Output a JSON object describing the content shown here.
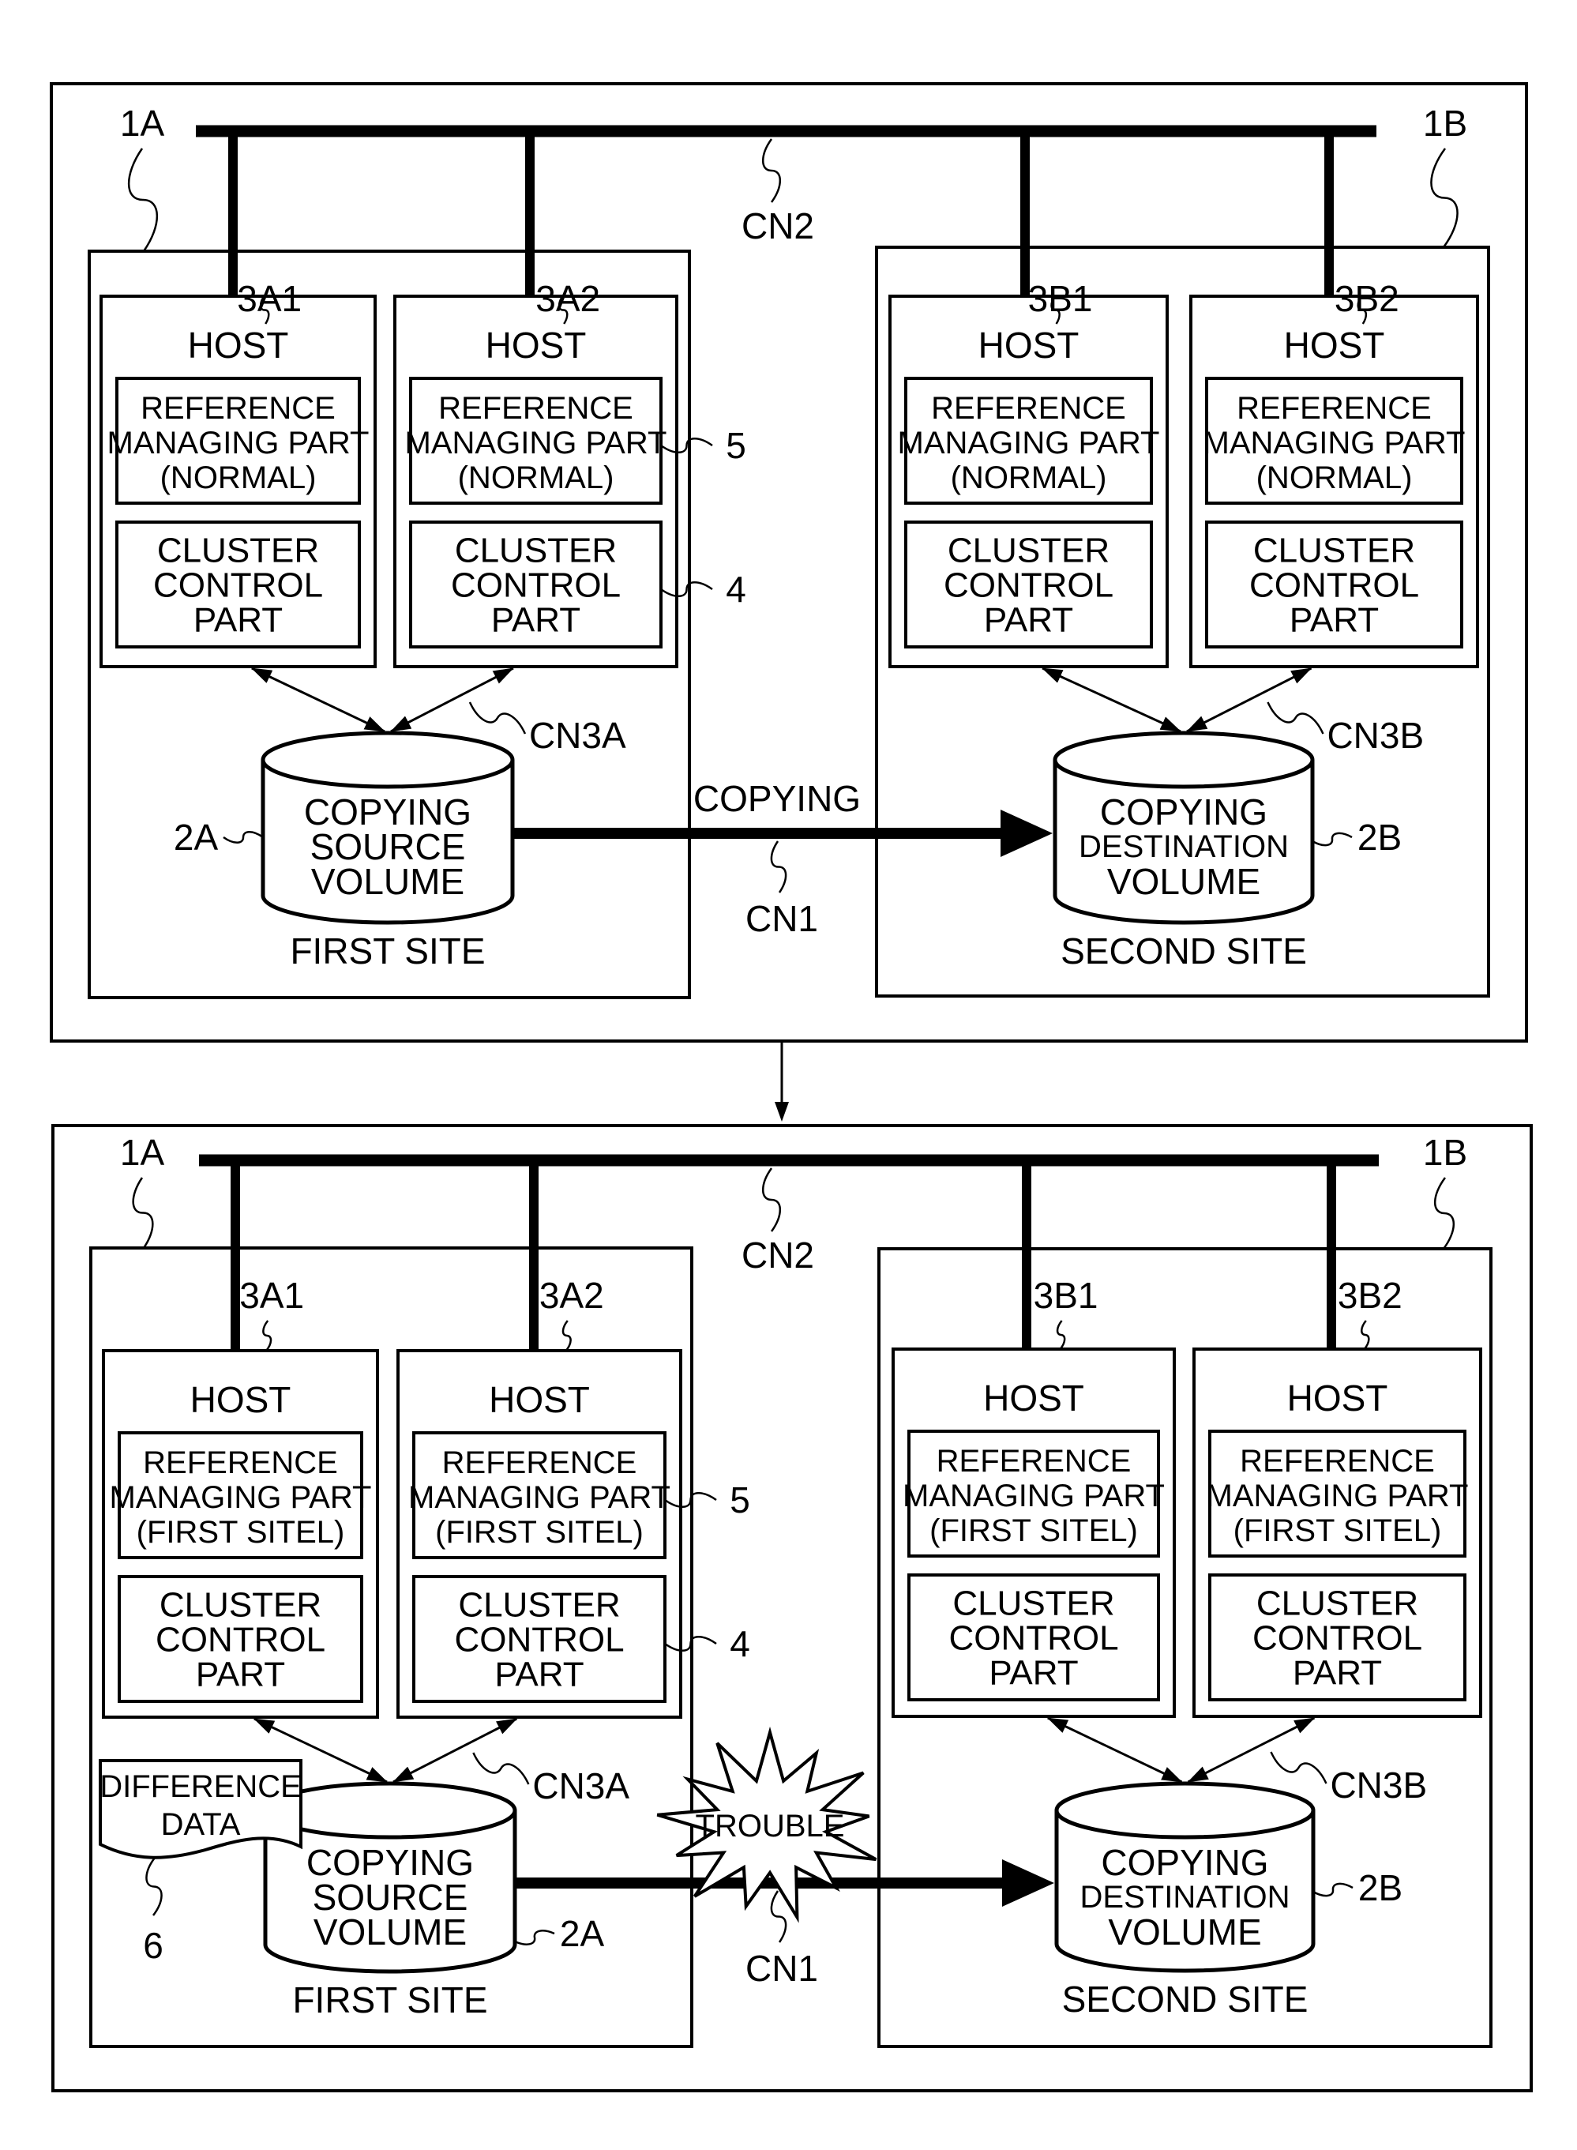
{
  "figure": {
    "colors": {
      "ink": "#000000",
      "paper": "#ffffff"
    },
    "panels": [
      {
        "id": "normal",
        "network_label": "CN2",
        "sites": [
          {
            "ref": "1A",
            "title": "FIRST SITE",
            "hosts": [
              {
                "ref": "3A1",
                "title": "HOST",
                "reference_part": [
                  "REFERENCE",
                  "MANAGING PART",
                  "(NORMAL)"
                ],
                "cluster_part": [
                  "CLUSTER",
                  "CONTROL",
                  "PART"
                ]
              },
              {
                "ref": "3A2",
                "title": "HOST",
                "reference_part": [
                  "REFERENCE",
                  "MANAGING PART",
                  "(NORMAL)"
                ],
                "cluster_part": [
                  "CLUSTER",
                  "CONTROL",
                  "PART"
                ]
              }
            ],
            "volume": {
              "ref": "2A",
              "lines": [
                "COPYING",
                "SOURCE",
                "VOLUME"
              ]
            },
            "link_label": "CN3A"
          },
          {
            "ref": "1B",
            "title": "SECOND SITE",
            "hosts": [
              {
                "ref": "3B1",
                "title": "HOST",
                "reference_part": [
                  "REFERENCE",
                  "MANAGING PART",
                  "(NORMAL)"
                ],
                "cluster_part": [
                  "CLUSTER",
                  "CONTROL",
                  "PART"
                ]
              },
              {
                "ref": "3B2",
                "title": "HOST",
                "reference_part": [
                  "REFERENCE",
                  "MANAGING PART",
                  "(NORMAL)"
                ],
                "cluster_part": [
                  "CLUSTER",
                  "CONTROL",
                  "PART"
                ]
              }
            ],
            "volume": {
              "ref": "2B",
              "lines": [
                "COPYING",
                "DESTINATION",
                "VOLUME"
              ]
            },
            "link_label": "CN3B"
          }
        ],
        "ref_part_label": "5",
        "cluster_part_label": "4",
        "copy_link": {
          "label": "CN1",
          "action": "COPYING"
        }
      },
      {
        "id": "trouble",
        "network_label": "CN2",
        "sites": [
          {
            "ref": "1A",
            "title": "FIRST SITE",
            "hosts": [
              {
                "ref": "3A1",
                "title": "HOST",
                "reference_part": [
                  "REFERENCE",
                  "MANAGING PART",
                  "(FIRST SITEL)"
                ],
                "cluster_part": [
                  "CLUSTER",
                  "CONTROL",
                  "PART"
                ]
              },
              {
                "ref": "3A2",
                "title": "HOST",
                "reference_part": [
                  "REFERENCE",
                  "MANAGING PART",
                  "(FIRST SITEL)"
                ],
                "cluster_part": [
                  "CLUSTER",
                  "CONTROL",
                  "PART"
                ]
              }
            ],
            "volume": {
              "ref": "2A",
              "lines": [
                "COPYING",
                "SOURCE",
                "VOLUME"
              ]
            },
            "link_label": "CN3A",
            "difference_data": {
              "ref": "6",
              "lines": [
                "DIFFERENCE",
                "DATA"
              ]
            }
          },
          {
            "ref": "1B",
            "title": "SECOND SITE",
            "hosts": [
              {
                "ref": "3B1",
                "title": "HOST",
                "reference_part": [
                  "REFERENCE",
                  "MANAGING PART",
                  "(FIRST SITEL)"
                ],
                "cluster_part": [
                  "CLUSTER",
                  "CONTROL",
                  "PART"
                ]
              },
              {
                "ref": "3B2",
                "title": "HOST",
                "reference_part": [
                  "REFERENCE",
                  "MANAGING PART",
                  "(FIRST SITEL)"
                ],
                "cluster_part": [
                  "CLUSTER",
                  "CONTROL",
                  "PART"
                ]
              }
            ],
            "volume": {
              "ref": "2B",
              "lines": [
                "COPYING",
                "DESTINATION",
                "VOLUME"
              ]
            },
            "link_label": "CN3B"
          }
        ],
        "ref_part_label": "5",
        "cluster_part_label": "4",
        "copy_link": {
          "label": "CN1",
          "trouble": "TROUBLE"
        }
      }
    ]
  }
}
